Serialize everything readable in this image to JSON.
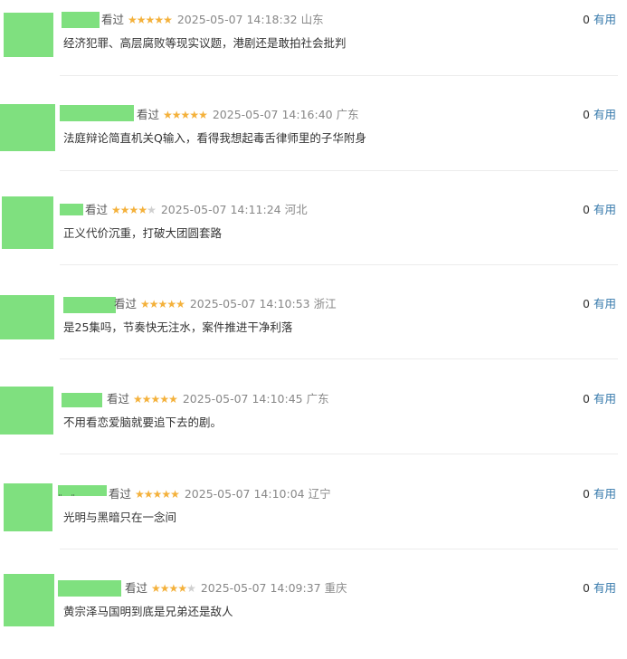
{
  "comments": [
    {
      "watched": "看过",
      "rating": 5,
      "time": "2025-05-07 14:18:32",
      "location": "山东",
      "text": "经济犯罪、高层腐败等现实议题，港剧还是敢拍社会批判",
      "votes": "0",
      "useful": "有用"
    },
    {
      "watched": "看过",
      "rating": 5,
      "time": "2025-05-07 14:16:40",
      "location": "广东",
      "text": "法庭辩论简直机关Q输入，看得我想起毒舌律师里的子华附身",
      "votes": "0",
      "useful": "有用"
    },
    {
      "watched": "看过",
      "rating": 4,
      "time": "2025-05-07 14:11:24",
      "location": "河北",
      "text": "正义代价沉重，打破大团圆套路",
      "votes": "0",
      "useful": "有用"
    },
    {
      "watched": "看过",
      "rating": 5,
      "time": "2025-05-07 14:10:53",
      "location": "浙江",
      "text": "是25集吗，节奏快无注水，案件推进干净利落",
      "votes": "0",
      "useful": "有用"
    },
    {
      "watched": "看过",
      "rating": 5,
      "time": "2025-05-07 14:10:45",
      "location": "广东",
      "text": "不用看恋爱脑就要追下去的剧。",
      "votes": "0",
      "useful": "有用"
    },
    {
      "watched": "看过",
      "rating": 5,
      "time": "2025-05-07 14:10:04",
      "location": "辽宁",
      "text": "光明与黑暗只在一念间",
      "votes": "0",
      "useful": "有用"
    },
    {
      "watched": "看过",
      "rating": 4,
      "time": "2025-05-07 14:09:37",
      "location": "重庆",
      "text": "黄宗泽马国明到底是兄弟还是敌人",
      "votes": "0",
      "useful": "有用"
    }
  ],
  "colors": {
    "avatar_placeholder": "#7fe07f",
    "star": "#f4b13b",
    "useful_link": "#3377aa"
  }
}
